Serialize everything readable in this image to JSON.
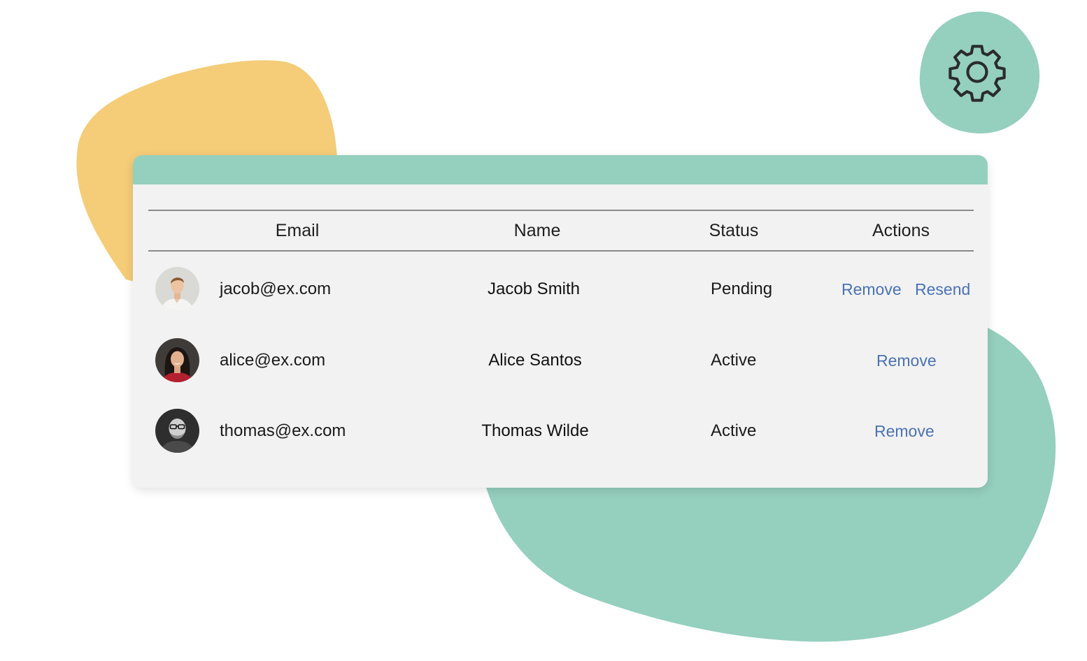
{
  "colors": {
    "header_bar": "#95cfbe",
    "blob_yellow": "#f5cc77",
    "blob_green": "#95cfbe",
    "link": "#4a72b5"
  },
  "icons": {
    "settings": "gear-icon"
  },
  "table": {
    "columns": [
      "Email",
      "Name",
      "Status",
      "Actions"
    ],
    "rows": [
      {
        "email": "jacob@ex.com",
        "name": "Jacob Smith",
        "status": "Pending",
        "actions": [
          "Remove",
          "Resend"
        ]
      },
      {
        "email": "alice@ex.com",
        "name": "Alice Santos",
        "status": "Active",
        "actions": [
          "Remove"
        ]
      },
      {
        "email": "thomas@ex.com",
        "name": "Thomas Wilde",
        "status": "Active",
        "actions": [
          "Remove"
        ]
      }
    ]
  }
}
